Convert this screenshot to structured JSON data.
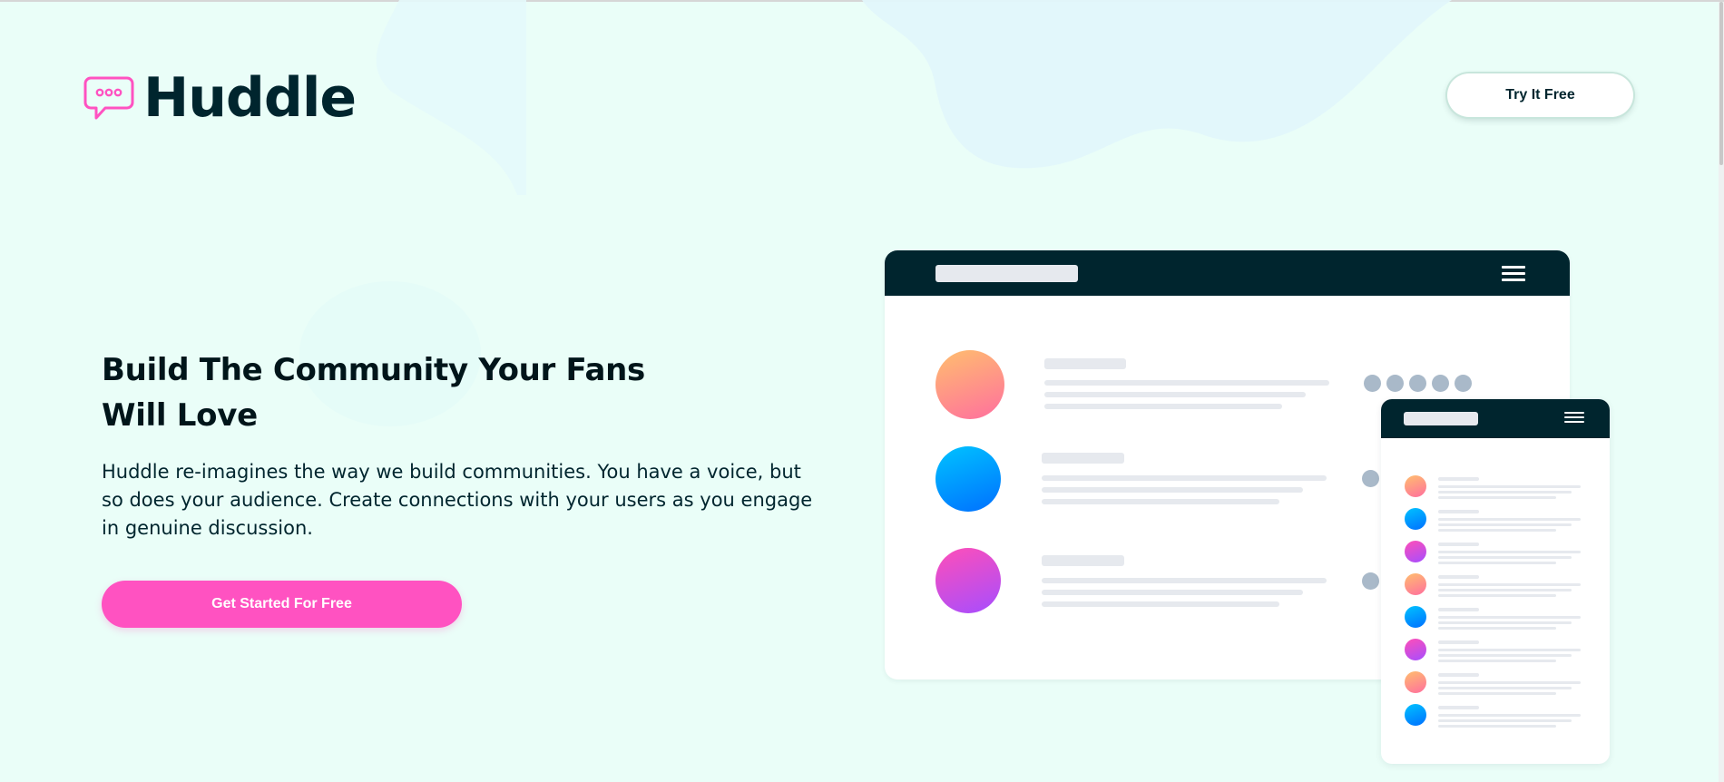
{
  "header": {
    "logo_text": "Huddle",
    "logo_icon": "chat-bubble-icon",
    "cta_label": "Try It Free"
  },
  "hero": {
    "title": "Build The Community Your Fans Will Love",
    "description": "Huddle re-imagines the way we build communities. You have a voice, but so does your audience. Create connections with your users as you engage in genuine discussion.",
    "cta_label": "Get Started For Free"
  },
  "illustration": {
    "desktop_rows": [
      "orange",
      "blue",
      "purple"
    ],
    "mobile_rows": [
      "orange",
      "blue",
      "purple",
      "orange",
      "blue",
      "purple",
      "orange",
      "blue"
    ]
  },
  "colors": {
    "background": "#eafef8",
    "brand_dark": "#00252e",
    "accent_pink": "#ff52c1",
    "logo_pink": "#ff52c1"
  }
}
